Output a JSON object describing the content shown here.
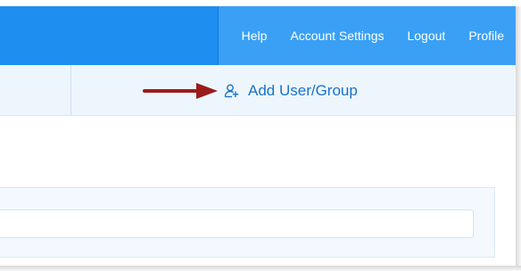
{
  "header": {
    "nav": [
      {
        "label": "Help"
      },
      {
        "label": "Account Settings"
      },
      {
        "label": "Logout"
      },
      {
        "label": "Profile"
      }
    ]
  },
  "toolbar": {
    "add_user_label": "Add User/Group",
    "add_user_icon": "add-user-icon"
  },
  "annotation": {
    "arrow_color": "#9b1c1c"
  },
  "colors": {
    "header_blue": "#1e8ef0",
    "header_right_blue": "#3aa0f5",
    "link_blue": "#1673c9"
  },
  "panel": {
    "input_value": ""
  }
}
